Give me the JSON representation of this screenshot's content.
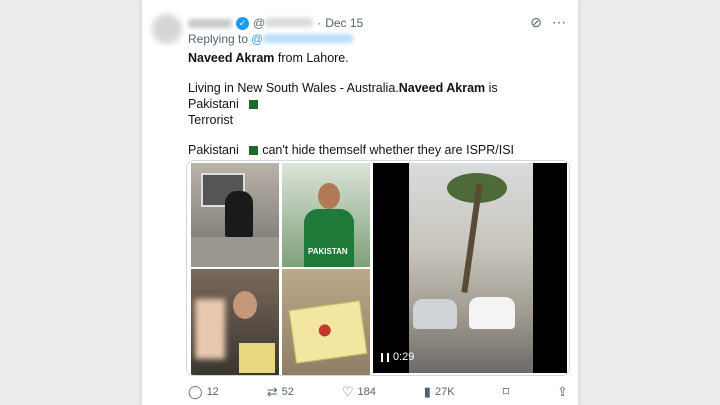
{
  "post": {
    "date": "Dec 15",
    "handle_prefix": "@",
    "reply_label": "Replying to",
    "reply_mention": "@",
    "line1_name": "Naveed Akram",
    "line1_rest": " from Lahore.",
    "line2_start": "Living in New South Wales - Australia.",
    "line2_name": "Naveed Akram",
    "line2_mid": " is Pakistani ",
    "line2_end": "Terrorist",
    "line3_start": "Pakistani ",
    "line3_end": "can't hide themself whether they are ISPR/ISI assets or Terrorists.",
    "shirt_text": "PAKISTAN",
    "video_duration": "0:29"
  },
  "actions": {
    "replies": "12",
    "reposts": "52",
    "likes": "184",
    "views": "27K"
  },
  "colors": {
    "accent": "#1d9bf0",
    "text": "#0f1419",
    "muted": "#536471"
  }
}
